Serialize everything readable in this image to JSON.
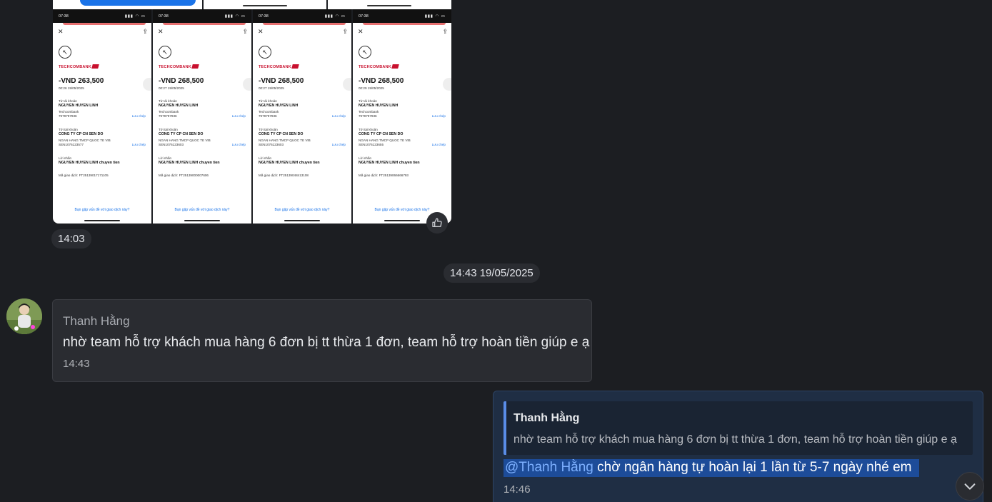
{
  "images": [
    {
      "status_time": "07:38",
      "amount": "-VND 263,500",
      "date": "00:26 19/05/2025",
      "from_label": "Từ tài khoản",
      "from_name": "NGUYEN HUYEN LINH",
      "from_bank": "Techcombank",
      "from_acct": "7979797936",
      "link_from": "Lưu chép",
      "to_label": "Tới tài khoản",
      "to_name": "CONG TY CP CN SEN DO",
      "to_bank": "NGAN HANG TMCP QUOC TE VIB",
      "to_acct": "SEN1076123577",
      "link_to": "Lưu chép",
      "msg_label": "Lời nhắn",
      "msg": "NGUYEN HUYEN LINH chuyen tien",
      "txn": "Mã giao dịch: FT25139017171105",
      "question": "Bạn gặp vấn đề với giao dịch này?"
    },
    {
      "status_time": "07:38",
      "amount": "-VND 268,500",
      "date": "00:27 19/05/2025",
      "from_label": "Từ tài khoản",
      "from_name": "NGUYEN HUYEN LINH",
      "from_bank": "Techcombank",
      "from_acct": "7979797936",
      "link_from": "Lưu chép",
      "to_label": "Tới tài khoản",
      "to_name": "CONG TY CP CN SEN DO",
      "to_bank": "NGAN HANG TMCP QUOC TE VIB",
      "to_acct": "SEN1076123603",
      "link_to": "Lưu chép",
      "msg_label": "Lời nhắn",
      "msg": "NGUYEN HUYEN LINH chuyen tien",
      "txn": "Mã giao dịch: FT25139000007606",
      "question": "Bạn gặp vấn đề với giao dịch này?"
    },
    {
      "status_time": "07:38",
      "amount": "-VND 268,500",
      "date": "00:27 19/05/2025",
      "from_label": "Từ tài khoản",
      "from_name": "NGUYEN HUYEN LINH",
      "from_bank": "Techcombank",
      "from_acct": "7979797936",
      "link_from": "Lưu chép",
      "to_label": "Tới tài khoản",
      "to_name": "CONG TY CP CN SEN DO",
      "to_bank": "NGAN HANG TMCP QUOC TE VIB",
      "to_acct": "SEN1076123603",
      "link_to": "Lưu chép",
      "msg_label": "Lời nhắn",
      "msg": "NGUYEN HUYEN LINH chuyen tien",
      "txn": "Mã giao dịch: FT25139048413108",
      "question": "Bạn gặp vấn đề với giao dịch này?"
    },
    {
      "status_time": "07:38",
      "amount": "-VND 268,500",
      "date": "00:29 19/05/2025",
      "from_label": "Từ tài khoản",
      "from_name": "NGUYEN HUYEN LINH",
      "from_bank": "Techcombank",
      "from_acct": "7979797936",
      "link_from": "Lưu chép",
      "to_label": "Tới tài khoản",
      "to_name": "CONG TY CP CN SEN DO",
      "to_bank": "NGAN HANG TMCP QUOC TE VIB",
      "to_acct": "SEN1076123655",
      "link_to": "Lưu chép",
      "msg_label": "Lời nhắn",
      "msg": "NGUYEN HUYEN LINH chuyen tien",
      "txn": "Mã giao dịch: FT25139066666793",
      "question": "Bạn gặp vấn đề với giao dịch này?"
    }
  ],
  "brand": "TECHCOMBANK",
  "image_message_time": "14:03",
  "date_separator": "14:43 19/05/2025",
  "incoming": {
    "sender": "Thanh Hằng",
    "text": "nhờ team hỗ trợ khách mua hàng 6 đơn bị tt thừa 1 đơn, team hỗ trợ hoàn tiền giúp e ạ",
    "time": "14:43"
  },
  "outgoing": {
    "quote_sender": "Thanh Hằng",
    "quote_text": "nhờ team hỗ trợ khách mua hàng 6 đơn bị tt thừa 1 đơn, team hỗ trợ hoàn tiền giúp e ạ",
    "mention": "@Thanh Hằng",
    "text": " chờ ngân hàng tự hoàn lại 1 lần từ 5-7 ngày nhé em",
    "time": "14:46"
  },
  "icons": {
    "like": "thumbs-up-icon",
    "scroll": "chevron-down-icon"
  },
  "colors": {
    "background": "#1c1e22",
    "incoming_bubble": "#2a2c31",
    "outgoing_bubble": "#1f2e44",
    "mention": "#7db0ff",
    "selection": "#1d4c99",
    "quote_bar": "#5a8de8"
  }
}
